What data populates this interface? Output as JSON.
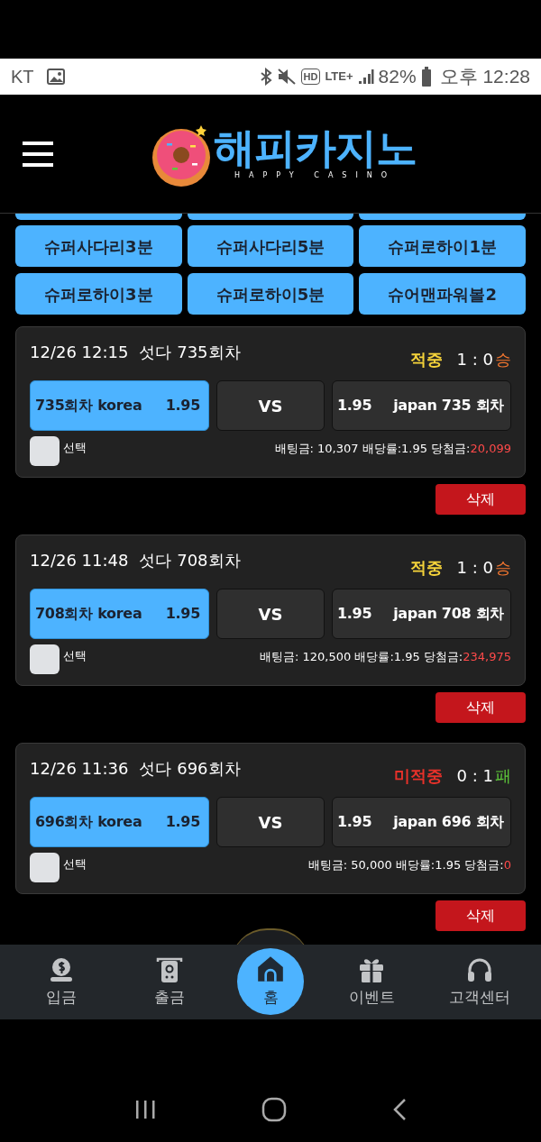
{
  "status_bar": {
    "carrier": "KT",
    "hd": "HD",
    "network": "LTE+",
    "battery": "82%",
    "time": "오후 12:28"
  },
  "header": {
    "logo_title": "해피카지노",
    "logo_subtitle": "HAPPY CASINO"
  },
  "game_buttons": [
    "슈퍼사다리3분",
    "슈퍼사다리5분",
    "슈퍼로하이1분",
    "슈퍼로하이3분",
    "슈퍼로하이5분",
    "슈어맨파워볼2"
  ],
  "bets": [
    {
      "datetime": "12/26 12:15",
      "game": "섯다 735회차",
      "result": {
        "kind": "hit",
        "label": "적중"
      },
      "score": "1 : 0",
      "outcome": {
        "kind": "win",
        "label": "승"
      },
      "home": {
        "name": "735회차 korea",
        "odds": "1.95",
        "selected": true
      },
      "vs": "VS",
      "away": {
        "odds": "1.95",
        "name": "japan 735 회차",
        "selected": false
      },
      "checkbox": {
        "label": "선택",
        "checked": false
      },
      "summary": "배팅금: 10,307 배당률:1.95 당첨금:",
      "payout": "20,099",
      "delete": "삭제"
    },
    {
      "datetime": "12/26 11:48",
      "game": "섯다 708회차",
      "result": {
        "kind": "hit",
        "label": "적중"
      },
      "score": "1 : 0",
      "outcome": {
        "kind": "win",
        "label": "승"
      },
      "home": {
        "name": "708회차 korea",
        "odds": "1.95",
        "selected": true
      },
      "vs": "VS",
      "away": {
        "odds": "1.95",
        "name": "japan 708 회차",
        "selected": false
      },
      "checkbox": {
        "label": "선택",
        "checked": false
      },
      "summary": "배팅금: 120,500 배당률:1.95 당첨금:",
      "payout": "234,975",
      "delete": "삭제"
    },
    {
      "datetime": "12/26 11:36",
      "game": "섯다 696회차",
      "result": {
        "kind": "miss",
        "label": "미적중"
      },
      "score": "0 : 1",
      "outcome": {
        "kind": "lose",
        "label": "패"
      },
      "home": {
        "name": "696회차 korea",
        "odds": "1.95",
        "selected": true
      },
      "vs": "VS",
      "away": {
        "odds": "1.95",
        "name": "japan 696 회차",
        "selected": false
      },
      "checkbox": {
        "label": "선택",
        "checked": false
      },
      "summary": "배팅금: 50,000 배당률:1.95 당첨금:",
      "payout": "0",
      "delete": "삭제"
    }
  ],
  "bottom_nav": [
    {
      "kind": "deposit",
      "label": "입금",
      "selected": false
    },
    {
      "kind": "withdraw",
      "label": "출금",
      "selected": false
    },
    {
      "kind": "home",
      "label": "홈",
      "selected": true
    },
    {
      "kind": "event",
      "label": "이벤트",
      "selected": false
    },
    {
      "kind": "support",
      "label": "고객센터",
      "selected": false
    }
  ]
}
